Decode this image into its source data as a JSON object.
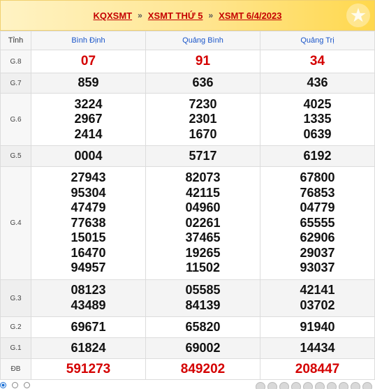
{
  "breadcrumb": {
    "item1": "KQXSMT",
    "sep1": "»",
    "item2": "XSMT THỨ 5",
    "sep2": "»",
    "item3": "XSMT 6/4/2023"
  },
  "table": {
    "header_label": "Tỉnh",
    "provinces": [
      "Bình Định",
      "Quảng Bình",
      "Quảng Trị"
    ],
    "prizes": [
      {
        "label": "G.8",
        "values": [
          [
            "07"
          ],
          [
            "91"
          ],
          [
            "34"
          ]
        ]
      },
      {
        "label": "G.7",
        "values": [
          [
            "859"
          ],
          [
            "636"
          ],
          [
            "436"
          ]
        ]
      },
      {
        "label": "G.6",
        "values": [
          [
            "3224",
            "2967",
            "2414"
          ],
          [
            "7230",
            "2301",
            "1670"
          ],
          [
            "4025",
            "1335",
            "0639"
          ]
        ]
      },
      {
        "label": "G.5",
        "values": [
          [
            "0004"
          ],
          [
            "5717"
          ],
          [
            "6192"
          ]
        ]
      },
      {
        "label": "G.4",
        "values": [
          [
            "27943",
            "95304",
            "47479",
            "77638",
            "15015",
            "16470",
            "94957"
          ],
          [
            "82073",
            "42115",
            "04960",
            "02261",
            "37465",
            "19265",
            "11502"
          ],
          [
            "67800",
            "76853",
            "04779",
            "65555",
            "62906",
            "29037",
            "93037"
          ]
        ]
      },
      {
        "label": "G.3",
        "values": [
          [
            "08123",
            "43489"
          ],
          [
            "05585",
            "84139"
          ],
          [
            "42141",
            "03702"
          ]
        ]
      },
      {
        "label": "G.2",
        "values": [
          [
            "69671"
          ],
          [
            "65820"
          ],
          [
            "91940"
          ]
        ]
      },
      {
        "label": "G.1",
        "values": [
          [
            "61824"
          ],
          [
            "69002"
          ],
          [
            "14434"
          ]
        ]
      },
      {
        "label": "ĐB",
        "values": [
          [
            "591273"
          ],
          [
            "849202"
          ],
          [
            "208447"
          ]
        ]
      }
    ]
  },
  "colors": {
    "accent_red": "#d40000",
    "province_blue": "#1a55c9",
    "header_gold": "#ffd84d"
  },
  "icons": {
    "header_decor": "star-icon"
  }
}
